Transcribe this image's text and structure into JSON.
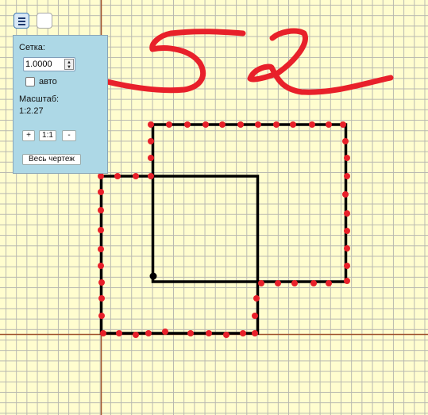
{
  "panel": {
    "grid_label": "Сетка:",
    "grid_value": "1.0000",
    "auto_label": "авто",
    "auto_checked": false,
    "scale_label": "Масштаб:",
    "scale_value": "1:2.27",
    "zoom_in_label": "+",
    "zoom_reset_label": "1:1",
    "zoom_out_label": "-",
    "fit_all_label": "Весь чертеж"
  },
  "toolbar": {
    "menu_icon": "hamburger-menu-icon",
    "blank_button_icon": "empty-square-icon"
  },
  "colors": {
    "paper": "#FFFDCF",
    "grid_line": "#B8B8B0",
    "axis_line": "#A0522D",
    "shape_line": "#000000",
    "marker_dot": "#E8202A",
    "annotation": "#E8202A",
    "panel_bg": "#ADD8E6"
  }
}
